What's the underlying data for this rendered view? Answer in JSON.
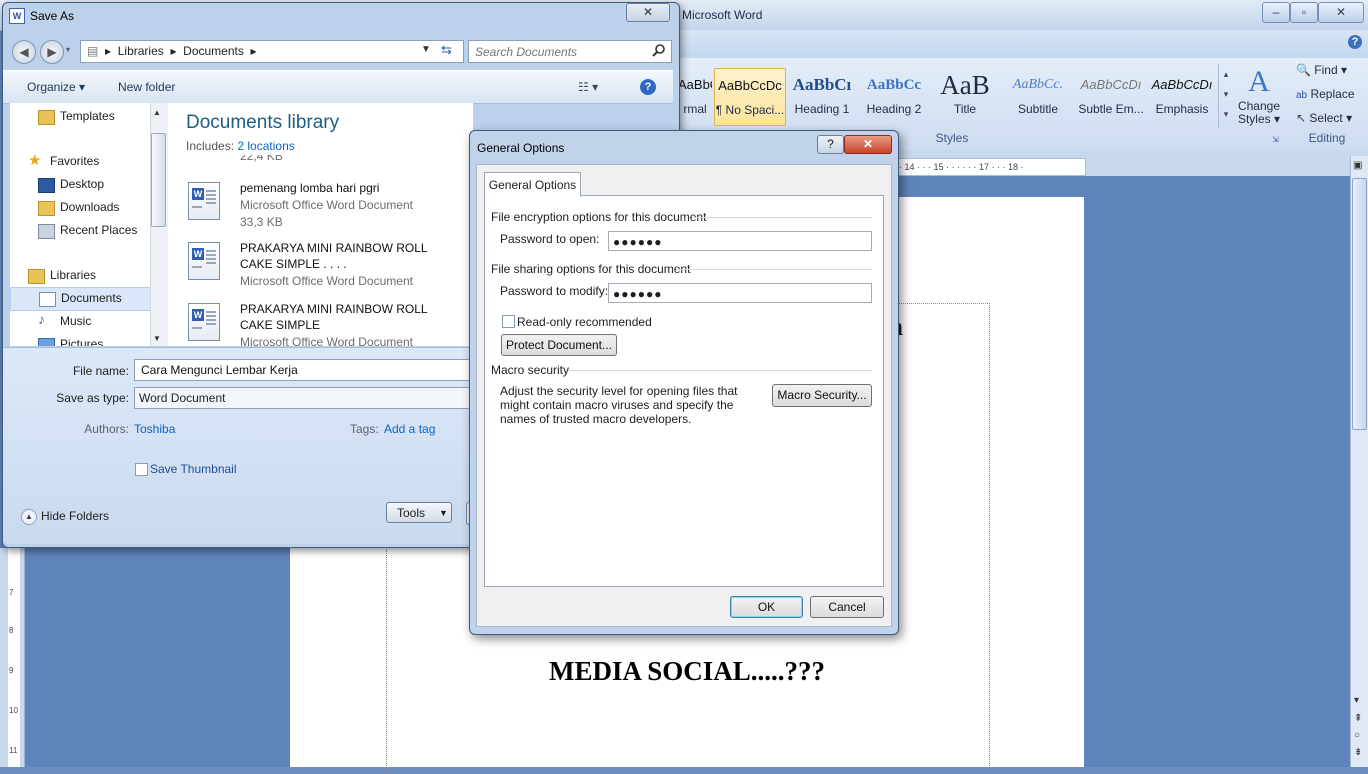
{
  "word": {
    "title": "Microsoft Word",
    "window_buttons": [
      "–",
      "▫",
      "✕"
    ],
    "styles": [
      {
        "sample": "AaBbCcDc",
        "name": "rmal"
      },
      {
        "sample": "AaBbCcDc",
        "name": "¶ No Spaci..."
      },
      {
        "sample": "AaBbCı",
        "name": "Heading 1"
      },
      {
        "sample": "AaBbCc",
        "name": "Heading 2"
      },
      {
        "sample": "AaB",
        "name": "Title"
      },
      {
        "sample": "AaBbCc.",
        "name": "Subtitle"
      },
      {
        "sample": "AaBbCcDı",
        "name": "Subtle Em..."
      },
      {
        "sample": "AaBbCcDı",
        "name": "Emphasis"
      }
    ],
    "change_styles": {
      "line1": "Change",
      "line2": "Styles ▾"
    },
    "styles_group": "Styles",
    "editing": {
      "find": "Find ▾",
      "replace": "Replace",
      "select": "Select ▾",
      "group": "Editing"
    },
    "ruler_text": "· 14 · · · 15 · · · · · · 17 · · · 18 ·",
    "vertical_ruler": [
      "11",
      "10",
      "9",
      "8",
      "7"
    ],
    "document_text": "MEDIA SOCIAL.....???",
    "document_partial_char": "a"
  },
  "saveas": {
    "title": "Save As",
    "close": "✕",
    "breadcrumb": [
      "Libraries",
      "Documents"
    ],
    "search_placeholder": "Search Documents",
    "toolbar": {
      "organize": "Organize ▾",
      "new_folder": "New folder",
      "help": "?"
    },
    "nav": {
      "templates": "Templates",
      "favorites": "Favorites",
      "desktop": "Desktop",
      "downloads": "Downloads",
      "recent_places": "Recent Places",
      "libraries": "Libraries",
      "documents": "Documents",
      "music": "Music",
      "pictures": "Pictures"
    },
    "library_title": "Documents library",
    "includes_label": "Includes:",
    "includes_link": "2 locations",
    "partial_size": "22,4 KB",
    "files": [
      {
        "name_line1": "pemenang lomba hari pgri",
        "name_line2": "",
        "type": "Microsoft Office Word Document",
        "size": "33,3 KB"
      },
      {
        "name_line1": "PRAKARYA MINI RAINBOW ROLL",
        "name_line2": "CAKE SIMPLE . . . .",
        "type": "Microsoft Office Word Document",
        "size": ""
      },
      {
        "name_line1": "PRAKARYA MINI RAINBOW ROLL",
        "name_line2": "CAKE SIMPLE",
        "type": "Microsoft Office Word Document",
        "size": ""
      }
    ],
    "file_name_label": "File name:",
    "file_name_value": "Cara Mengunci Lembar Kerja",
    "save_type_label": "Save as type:",
    "save_type_value": "Word Document",
    "authors_label": "Authors:",
    "authors_value": "Toshiba",
    "tags_label": "Tags:",
    "tags_value": "Add a tag",
    "save_thumbnail": "Save Thumbnail",
    "hide_folders": "Hide Folders",
    "tools": "Tools"
  },
  "general_options": {
    "title": "General Options",
    "help": "?",
    "close": "✕",
    "tab": "General Options",
    "encryption_section": "File encryption options for this document",
    "password_open_label": "Password to open:",
    "password_open_value": "●●●●●●",
    "sharing_section": "File sharing options for this document",
    "password_modify_label": "Password to modify:",
    "password_modify_value": "●●●●●●",
    "readonly_label": "Read-only recommended",
    "protect_button": "Protect Document...",
    "macro_section": "Macro security",
    "macro_desc": "Adjust the security level for opening files that might contain macro viruses and specify the names of trusted macro developers.",
    "macro_button": "Macro Security...",
    "ok": "OK",
    "cancel": "Cancel"
  }
}
